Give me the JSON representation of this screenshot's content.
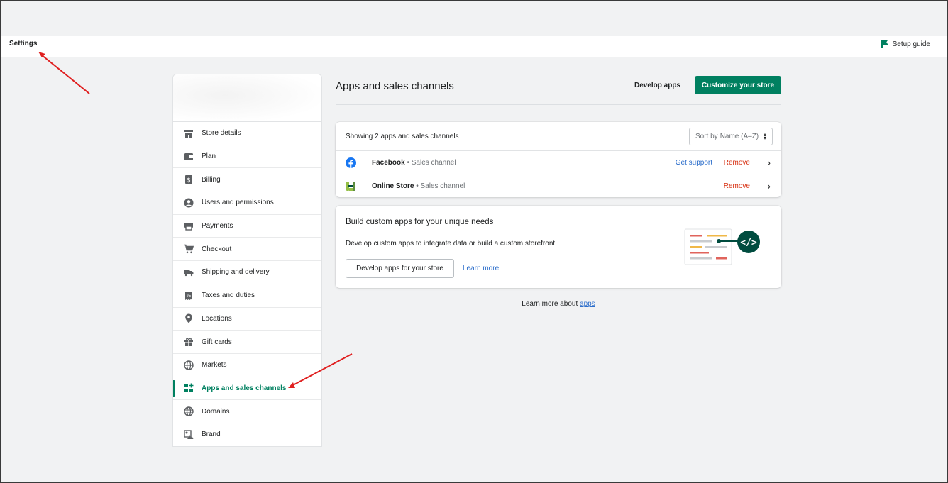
{
  "topbar": {
    "title": "Settings",
    "setup_guide": "Setup guide"
  },
  "sidebar": {
    "items": [
      {
        "label": "Store details",
        "icon": "store-icon"
      },
      {
        "label": "Plan",
        "icon": "plan-icon"
      },
      {
        "label": "Billing",
        "icon": "billing-icon"
      },
      {
        "label": "Users and permissions",
        "icon": "user-icon"
      },
      {
        "label": "Payments",
        "icon": "payments-icon"
      },
      {
        "label": "Checkout",
        "icon": "cart-icon"
      },
      {
        "label": "Shipping and delivery",
        "icon": "truck-icon"
      },
      {
        "label": "Taxes and duties",
        "icon": "tax-icon"
      },
      {
        "label": "Locations",
        "icon": "location-pin-icon"
      },
      {
        "label": "Gift cards",
        "icon": "gift-icon"
      },
      {
        "label": "Markets",
        "icon": "globe-icon"
      },
      {
        "label": "Apps and sales channels",
        "icon": "apps-icon",
        "active": true
      },
      {
        "label": "Domains",
        "icon": "domains-globe-icon"
      },
      {
        "label": "Brand",
        "icon": "brand-icon"
      }
    ]
  },
  "main": {
    "title": "Apps and sales channels",
    "develop_apps": "Develop apps",
    "customize": "Customize your store",
    "list": {
      "showing": "Showing 2 apps and sales channels",
      "sort_label": "Sort by",
      "sort_value": "Name (A–Z)",
      "rows": [
        {
          "name": "Facebook",
          "sub": " • Sales channel",
          "support": "Get support",
          "remove": "Remove"
        },
        {
          "name": "Online Store",
          "sub": " • Sales channel",
          "remove": "Remove"
        }
      ]
    },
    "build": {
      "title": "Build custom apps for your unique needs",
      "desc": "Develop custom apps to integrate data or build a custom storefront.",
      "button": "Develop apps for your store",
      "learn": "Learn more"
    },
    "footer": {
      "prefix": "Learn more about ",
      "link": "apps"
    }
  },
  "colors": {
    "accent": "#008060",
    "link": "#2c6ecb",
    "danger": "#d72c0d",
    "annotation": "#e02020"
  }
}
